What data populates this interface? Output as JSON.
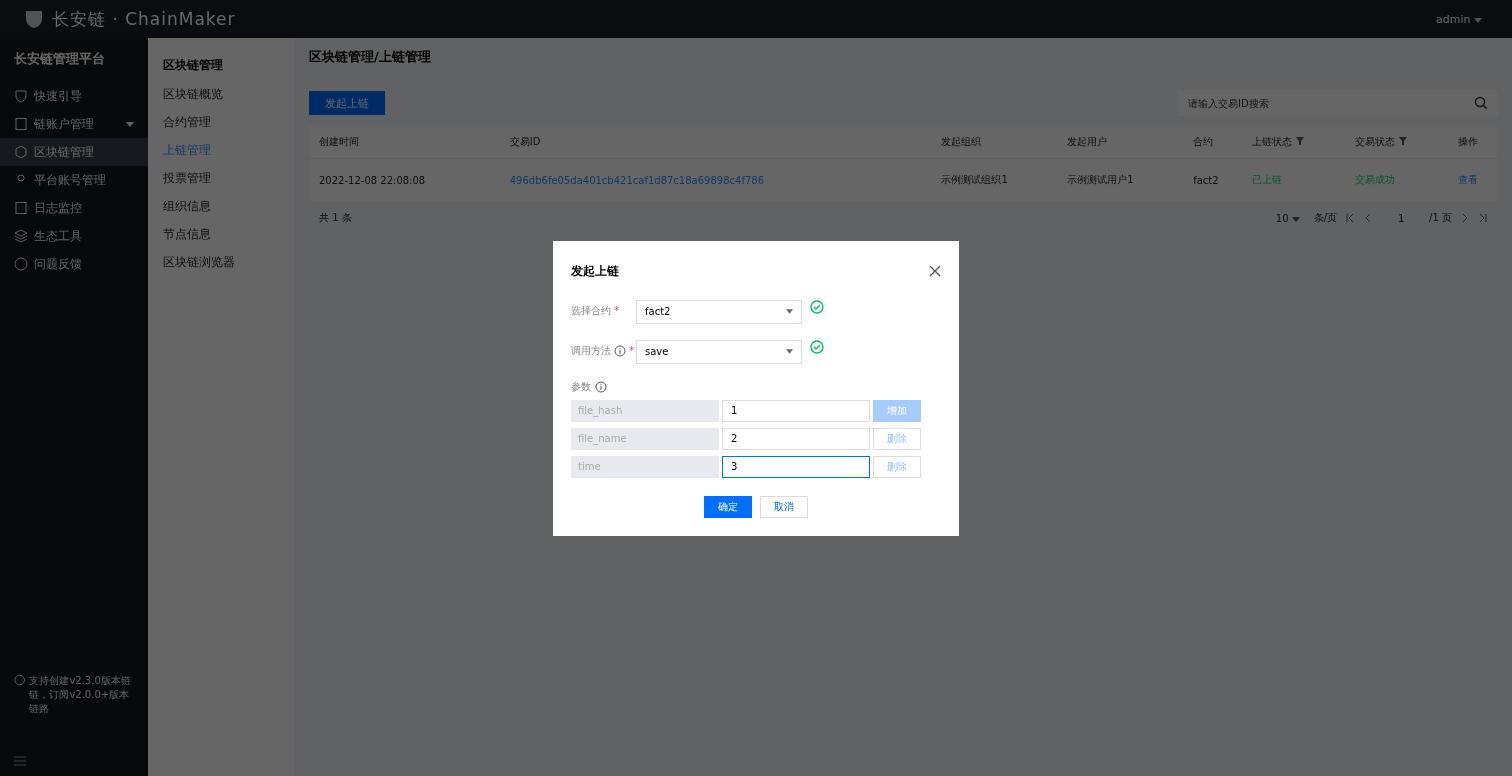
{
  "topbar": {
    "logo": "长安链 · ChainMaker",
    "user": "admin"
  },
  "sidebar": {
    "title": "长安链管理平台",
    "items": [
      {
        "label": "快速引导",
        "expandable": false,
        "selected": false
      },
      {
        "label": "链账户管理",
        "expandable": true,
        "selected": false
      },
      {
        "label": "区块链管理",
        "expandable": false,
        "selected": true
      },
      {
        "label": "平台账号管理",
        "expandable": false,
        "selected": false
      },
      {
        "label": "日志监控",
        "expandable": false,
        "selected": false
      },
      {
        "label": "生态工具",
        "expandable": false,
        "selected": false
      },
      {
        "label": "问题反馈",
        "expandable": false,
        "selected": false
      }
    ],
    "note": "支持创建v2.3.0版本链链，订阅v2.0.0+版本链路"
  },
  "subnav": {
    "title": "区块链管理",
    "items": [
      {
        "label": "区块链概览",
        "selected": false
      },
      {
        "label": "合约管理",
        "selected": false
      },
      {
        "label": "上链管理",
        "selected": true
      },
      {
        "label": "投票管理",
        "selected": false
      },
      {
        "label": "组织信息",
        "selected": false
      },
      {
        "label": "节点信息",
        "selected": false
      },
      {
        "label": "区块链浏览器",
        "selected": false
      }
    ]
  },
  "page": {
    "breadcrumb": "区块链管理/上链管理",
    "primary_button": "发起上链",
    "search": {
      "placeholder": "请输入交易ID搜索"
    },
    "table": {
      "columns": [
        {
          "label": "创建时间",
          "filterable": false
        },
        {
          "label": "交易ID",
          "filterable": false
        },
        {
          "label": "发起组织",
          "filterable": false
        },
        {
          "label": "发起用户",
          "filterable": false
        },
        {
          "label": "合约",
          "filterable": false
        },
        {
          "label": "上链状态",
          "filterable": true
        },
        {
          "label": "交易状态",
          "filterable": true
        },
        {
          "label": "操作",
          "filterable": false
        }
      ],
      "rows": [
        {
          "cells": [
            {
              "text": "2022-12-08 22:08:08",
              "kind": "text"
            },
            {
              "text": "496db6fe05da401cb421caf1d87c18a69898c4f786",
              "kind": "link"
            },
            {
              "text": "示例测试组织1",
              "kind": "text"
            },
            {
              "text": "示例测试用户1",
              "kind": "text"
            },
            {
              "text": "fact2",
              "kind": "text"
            },
            {
              "text": "已上链",
              "kind": "success"
            },
            {
              "text": "交易成功",
              "kind": "success"
            },
            {
              "text": "查看",
              "kind": "link"
            }
          ]
        }
      ]
    },
    "pagination": {
      "total": "共 1 条",
      "page_size": "10",
      "page_size_unit": "条/页",
      "page": "1",
      "pages": "/1 页"
    }
  },
  "dialog": {
    "title": "发起上链",
    "fields": [
      {
        "label": "选择合约",
        "info": false,
        "required_mark": "*",
        "value": "fact2",
        "valid": true
      },
      {
        "label": "调用方法",
        "info": true,
        "required_mark": "*",
        "value": "save",
        "valid": true
      }
    ],
    "params_label": "参数",
    "params": [
      {
        "key": "file_hash",
        "value": "1",
        "focused": false,
        "action": {
          "label": "增加",
          "kind": "add"
        }
      },
      {
        "key": "file_name",
        "value": "2",
        "focused": false,
        "action": {
          "label": "删除",
          "kind": "delete"
        }
      },
      {
        "key": "time",
        "value": "3",
        "focused": true,
        "action": {
          "label": "删除",
          "kind": "delete"
        }
      }
    ],
    "confirm": "确定",
    "cancel": "取消"
  }
}
